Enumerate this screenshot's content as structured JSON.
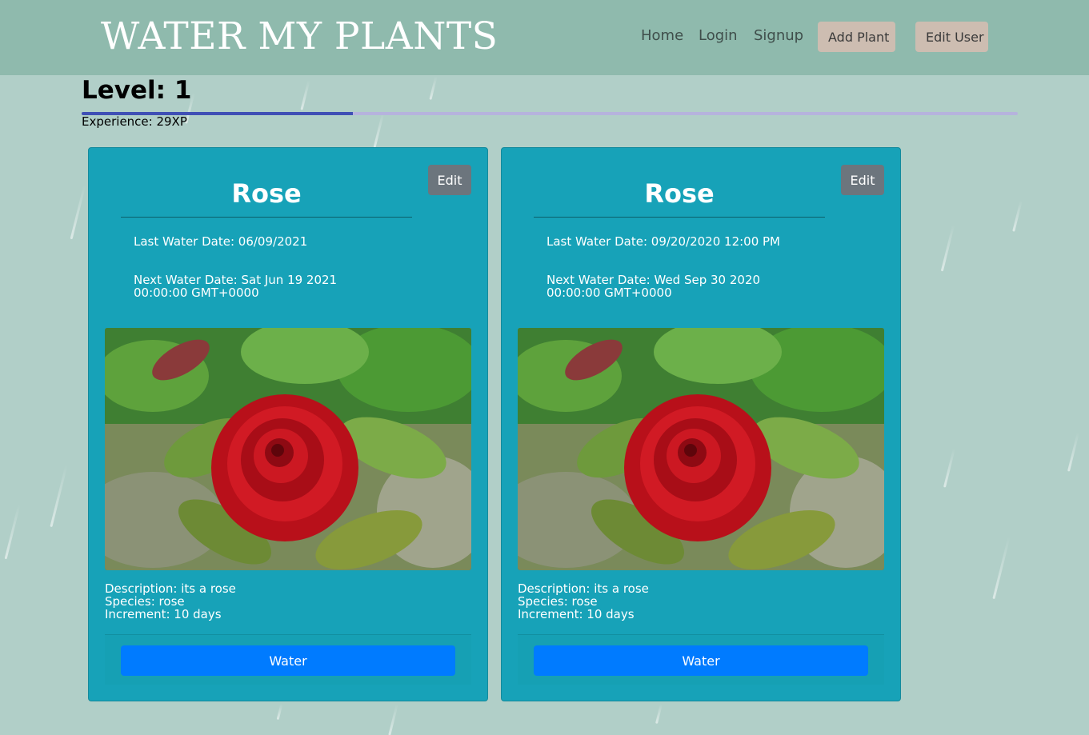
{
  "header": {
    "brand": "WATER MY PLANTS",
    "nav": {
      "home": "Home",
      "login": "Login",
      "signup": "Signup",
      "add_plant": "Add Plant",
      "edit_user": "Edit User"
    },
    "colors": {
      "bar": "#8fbaad",
      "nav_button": "#cdbdb1"
    }
  },
  "progress": {
    "level_text": "Level: 1",
    "experience_text": "Experience: 29XP",
    "fill_fraction": 0.29
  },
  "cards": [
    {
      "edit_label": "Edit",
      "name": "Rose",
      "last_water": "Last Water Date: 06/09/2021",
      "next_water": "Next Water Date: Sat Jun 19 2021 00:00:00 GMT+0000",
      "description": "Description: its a rose",
      "species": "Species: rose",
      "increment": "Increment: 10 days",
      "water_label": "Water"
    },
    {
      "edit_label": "Edit",
      "name": "Rose",
      "last_water": "Last Water Date: 09/20/2020 12:00 PM",
      "next_water": "Next Water Date: Wed Sep 30 2020 00:00:00 GMT+0000",
      "description": "Description: its a rose",
      "species": "Species: rose",
      "increment": "Increment: 10 days",
      "water_label": "Water"
    }
  ],
  "colors": {
    "page_background": "#b1cfc8",
    "card": "#17a2b8",
    "edit_button": "#6c757d",
    "water_button": "#007bff",
    "xp_fill": "#3f4fb5",
    "xp_track": "#b6b3dd"
  }
}
